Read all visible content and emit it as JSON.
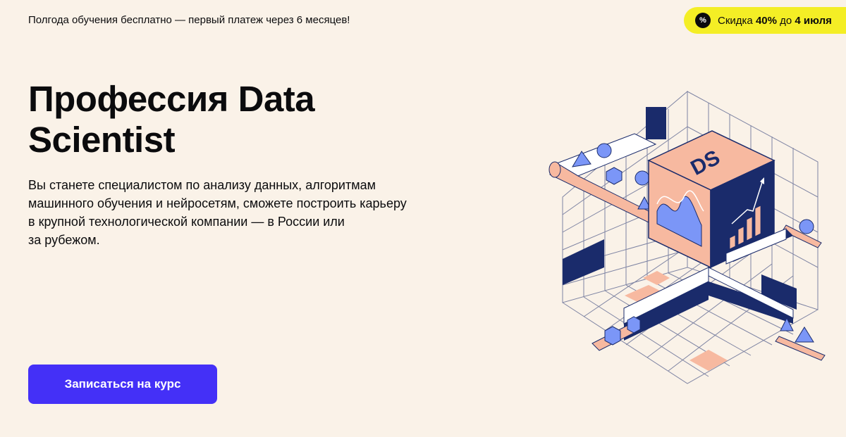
{
  "top_bar": {
    "promo_text": "Полгода обучения бесплатно — первый платеж через 6 месяцев!",
    "discount": {
      "icon": "percent-icon",
      "prefix": "Скидка ",
      "amount": "40%",
      "middle": " до ",
      "date": "4 июля"
    }
  },
  "hero": {
    "title": "Профессия Data Scientist",
    "description_lines": [
      "Вы станете специалистом по анализу данных, алгоритмам",
      "машинного обучения и нейросетям, сможете построить карьеру",
      "в крупной технологической компании — в России или",
      "за рубежом."
    ],
    "cta_label": "Записаться на курс"
  },
  "illustration": {
    "cube_label": "DS",
    "colors": {
      "navy": "#1a2b6b",
      "peach": "#f7b9a0",
      "blue": "#7b96f7",
      "accent": "#4430f7",
      "yellow": "#f4ee25"
    }
  }
}
